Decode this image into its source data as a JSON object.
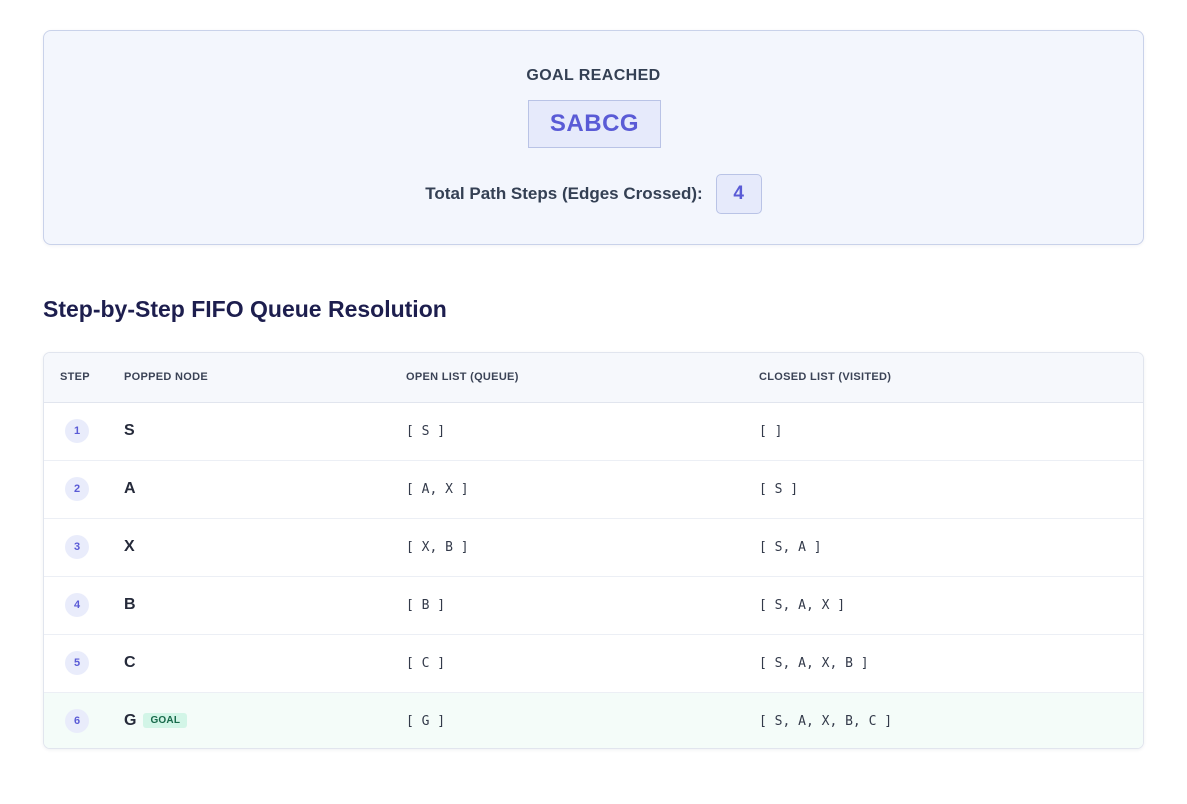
{
  "summary": {
    "heading": "GOAL REACHED",
    "path": "SABCG",
    "steps_label": "Total Path Steps (Edges Crossed):",
    "steps_value": "4"
  },
  "section_title": "Step-by-Step FIFO Queue Resolution",
  "table": {
    "columns": [
      "STEP",
      "POPPED NODE",
      "OPEN LIST (QUEUE)",
      "CLOSED LIST (VISITED)"
    ],
    "rows": [
      {
        "step": "1",
        "node": "S",
        "open": "[ S ]",
        "closed": "[ ]"
      },
      {
        "step": "2",
        "node": "A",
        "open": "[ A, X ]",
        "closed": "[ S ]"
      },
      {
        "step": "3",
        "node": "X",
        "open": "[ X, B ]",
        "closed": "[ S, A ]"
      },
      {
        "step": "4",
        "node": "B",
        "open": "[ B ]",
        "closed": "[ S, A, X ]"
      },
      {
        "step": "5",
        "node": "C",
        "open": "[ C ]",
        "closed": "[ S, A, X, B ]"
      },
      {
        "step": "6",
        "node": "G",
        "goal_tag": "GOAL",
        "open": "[ G ]",
        "closed": "[ S, A, X, B, C ]"
      }
    ]
  },
  "colors": {
    "accent": "#5a5bd6",
    "goal_tag_bg": "#d2f5e7",
    "goal_tag_text": "#17694a",
    "card_bg": "#f3f6fd"
  }
}
